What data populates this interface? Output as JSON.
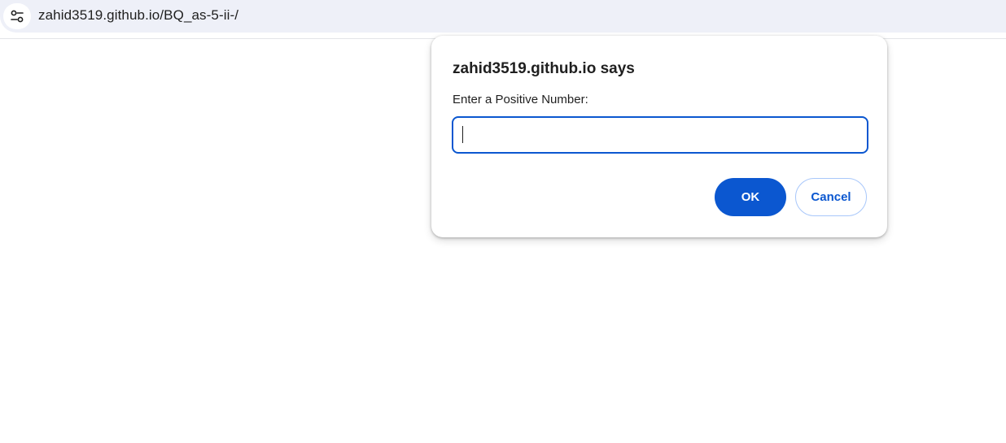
{
  "browser": {
    "url": "zahid3519.github.io/BQ_as-5-ii-/",
    "site_info_icon": "tune-icon"
  },
  "dialog": {
    "title": "zahid3519.github.io says",
    "message": "Enter a Positive Number:",
    "input_value": "",
    "ok_label": "OK",
    "cancel_label": "Cancel"
  },
  "colors": {
    "accent": "#0b57d0",
    "omnibox_bg": "#eef0f8",
    "cancel_border": "#a8c7fa",
    "text": "#1f1f1f"
  }
}
